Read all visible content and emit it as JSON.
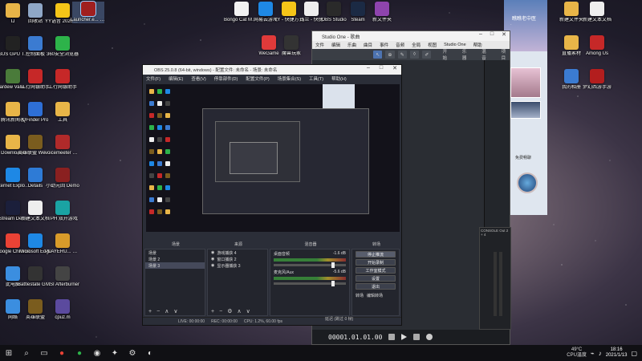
{
  "desktop": {
    "left_icons": [
      {
        "label": "IJ",
        "icon": "folder-icon",
        "color": "#e8b548"
      },
      {
        "label": "回收站",
        "icon": "recycle-bin-icon",
        "color": "#8fa7c7"
      },
      {
        "label": "ASUS GPU Tweak II",
        "icon": "asus-icon",
        "color": "#222"
      },
      {
        "label": "控制面板",
        "icon": "control-panel-icon",
        "color": "#3b7bd1"
      },
      {
        "label": "Stardew Valley So...",
        "icon": "game-icon",
        "color": "#4a7b3a"
      },
      {
        "label": "工行网银助手",
        "icon": "bank-icon",
        "color": "#c62828"
      },
      {
        "label": "腾讯新闻客",
        "icon": "folder-icon",
        "color": "#e8b548"
      },
      {
        "label": "QFinder Pro",
        "icon": "qfinder-icon",
        "color": "#2e6fd6"
      },
      {
        "label": "Downloads",
        "icon": "folder-icon",
        "color": "#e8b548"
      },
      {
        "label": "英雄联盟 WeGame版",
        "icon": "lol-icon",
        "color": "#7a5c1e"
      },
      {
        "label": "Internet Explorer",
        "icon": "ie-icon",
        "color": "#1e88e5"
      },
      {
        "label": "Details",
        "icon": "globe-icon",
        "color": "#2e7bd6"
      },
      {
        "label": "Stream Deck",
        "icon": "stream-deck-icon",
        "color": "#1b1f3b"
      },
      {
        "label": "新建文本文档",
        "icon": "text-doc-icon",
        "color": "#eeeeee"
      },
      {
        "label": "Google Chrome",
        "icon": "chrome-icon",
        "color": "#e94235"
      },
      {
        "label": "Microsoft Edge",
        "icon": "edge-icon",
        "color": "#1e88e5"
      },
      {
        "label": "此电脑",
        "icon": "computer-icon",
        "color": "#3b8ee0"
      },
      {
        "label": "Battlestate Games L...",
        "icon": "bsg-icon",
        "color": "#333"
      },
      {
        "label": "网络",
        "icon": "network-icon",
        "color": "#3b8ee0"
      },
      {
        "label": "英雄联盟",
        "icon": "lol-icon",
        "color": "#7a5c1e"
      }
    ],
    "col2_icons": [
      {
        "label": "YY语音 20201105...",
        "icon": "yy-icon",
        "color": "#f5c518"
      },
      {
        "label": "360安全浏览器",
        "icon": "browser-360-icon",
        "color": "#2db34a"
      },
      {
        "label": "工行网银助手",
        "icon": "bank-icon",
        "color": "#c62828"
      },
      {
        "label": "工具",
        "icon": "folder-icon",
        "color": "#e8b548"
      },
      {
        "label": "voicemeeter 快捷方式",
        "icon": "voicemeeter-icon",
        "color": "#b02a2a"
      },
      {
        "label": "小幼元回 Demo",
        "icon": "game-icon",
        "color": "#8a2020"
      },
      {
        "label": "TPH 双开游戏",
        "icon": "tph-icon",
        "color": "#1aa3a3"
      },
      {
        "label": "PLAYERU... BATTLEGR...",
        "icon": "pubg-icon",
        "color": "#d89b2a"
      },
      {
        "label": "MSI Afterburner",
        "icon": "msi-icon",
        "color": "#444"
      },
      {
        "label": "cpuz.m",
        "icon": "cpuz-icon",
        "color": "#5b4a9e"
      }
    ],
    "top_icons": [
      {
        "label": "Launcher.e... mexe - 快捷方式",
        "icon": "launcher-icon",
        "color": "#a01f1f",
        "selected": true
      },
      {
        "label": "Bongo Cat Mver.exe",
        "icon": "bongo-cat-icon",
        "color": "#f2f2f2"
      },
      {
        "label": "网易云游戏",
        "icon": "cloud-game-icon",
        "color": "#1e88e5"
      },
      {
        "label": "YY - 快捷方式",
        "icon": "yy-icon",
        "color": "#f5c518"
      },
      {
        "label": "钱兰 - 快捷",
        "icon": "app-icon",
        "color": "#eeeeee"
      },
      {
        "label": "OBS Studio",
        "icon": "obs-icon",
        "color": "#2a2a2a"
      },
      {
        "label": "Steam",
        "icon": "steam-icon",
        "color": "#1b2a44"
      },
      {
        "label": "新文件夹",
        "icon": "folder-icon",
        "color": "#8e44ad"
      },
      {
        "label": "WeGame",
        "icon": "wegame-icon",
        "color": "#e03a3a"
      },
      {
        "label": "魔兽玩家",
        "icon": "game-icon",
        "color": "#333"
      }
    ],
    "right_icons": [
      {
        "label": "新建文件夹",
        "icon": "folder-icon",
        "color": "#e8b548"
      },
      {
        "label": "新建文本文档",
        "icon": "text-doc-icon",
        "color": "#eeeeee"
      },
      {
        "label": "直播素材",
        "icon": "folder-icon",
        "color": "#e8b548"
      },
      {
        "label": "Among Us",
        "icon": "among-us-icon",
        "color": "#c62828"
      },
      {
        "label": "我的相册",
        "icon": "album-icon",
        "color": "#3b7bd1"
      },
      {
        "label": "梦幻西游手游",
        "icon": "game-icon",
        "color": "#b31e1e"
      }
    ]
  },
  "studio_one": {
    "title": "Studio One - 歌曲",
    "menu": [
      "文件",
      "编辑",
      "乐曲",
      "曲目",
      "事件",
      "音频",
      "全局",
      "视图",
      "Studio One",
      "帮助"
    ],
    "toolbar_labels": [
      "开始",
      "乐器",
      "混音",
      "项目"
    ],
    "time": "00001.01.01.00",
    "console_label": "CONSOLE Out 2 + 4"
  },
  "chat": {
    "name": "瞧瞧老中医",
    "subtitle": "·",
    "caption": "免费畅聊"
  },
  "obs": {
    "title": "OBS 25.0.8 (64-bit, windows) - 配置文件: 未命名 - 场景: 未命名",
    "menu": [
      "文件(F)",
      "编辑(E)",
      "查看(V)",
      "停靠部件(D)",
      "配置文件(P)",
      "场景集合(S)",
      "工具(T)",
      "帮助(H)"
    ],
    "dock_titles": [
      "场景",
      "来源",
      "混音器",
      "转场",
      "控件"
    ],
    "scenes": [
      "场景",
      "场景 2",
      "场景 3"
    ],
    "sources": [
      "游戏捕获 4",
      "窗口捕获 2",
      "显示器捕获 3"
    ],
    "mixer": [
      {
        "name": "桌面音频",
        "db": "-1.6 dB"
      },
      {
        "name": "麦克风/Aux",
        "db": "-5.6 dB"
      }
    ],
    "controls": [
      "停止推流",
      "开始录制",
      "工作室模式",
      "设置",
      "退出"
    ],
    "transition_labels": [
      "转场",
      "编辑转场"
    ],
    "status": [
      "LIVE: 00:00:00",
      "REC: 00:00:00",
      "CPU: 1.2%, 60.00 fps"
    ],
    "extra_status": "延迟 (跳过 0 帧)"
  },
  "taskbar": {
    "temp": "49°C",
    "cpu_label": "CPU温度",
    "time": "18:16",
    "date": "2021/1/13"
  }
}
